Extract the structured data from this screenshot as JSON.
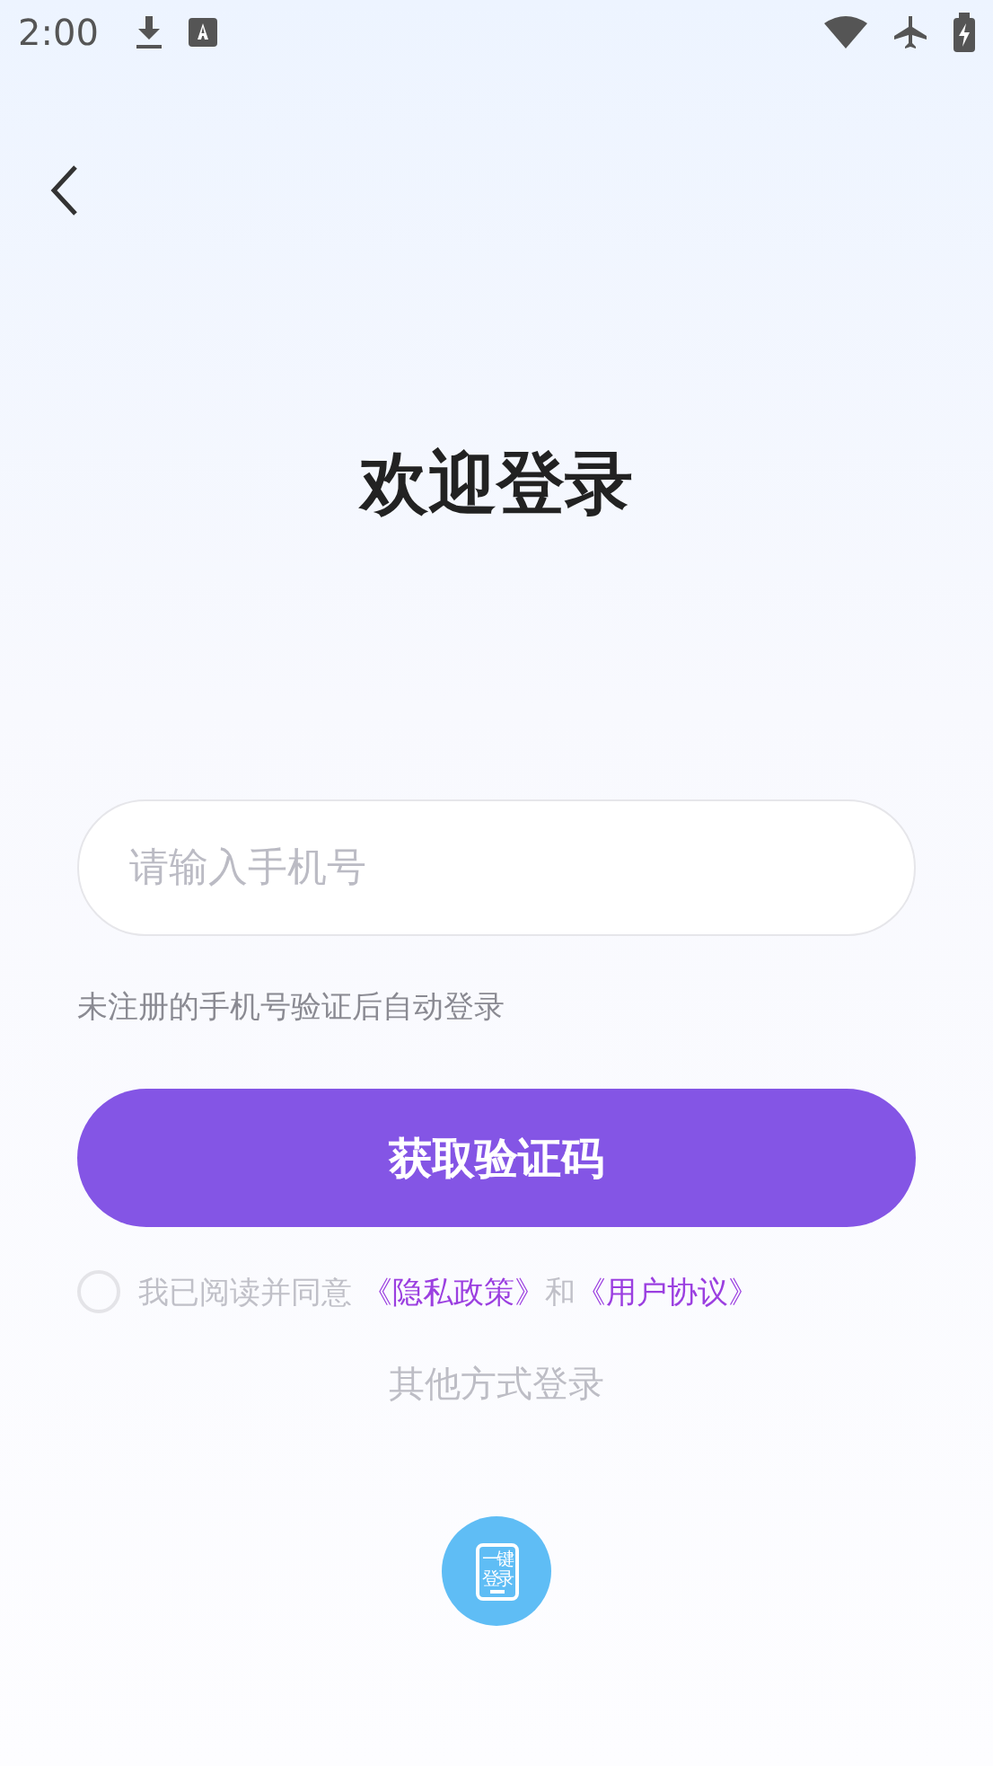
{
  "status_bar": {
    "time": "2:00"
  },
  "title": "欢迎登录",
  "phone_field": {
    "placeholder": "请输入手机号"
  },
  "hint": "未注册的手机号验证后自动登录",
  "submit_button": "获取验证码",
  "agreement": {
    "checked": false,
    "prefix": "我已阅读并同意",
    "privacy_link": "《隐私政策》",
    "joiner": "和",
    "terms_link": "《用户协议》"
  },
  "other_methods": "其他方式登录",
  "one_tap_login": {
    "label_top": "一键",
    "label_bottom": "登录"
  }
}
